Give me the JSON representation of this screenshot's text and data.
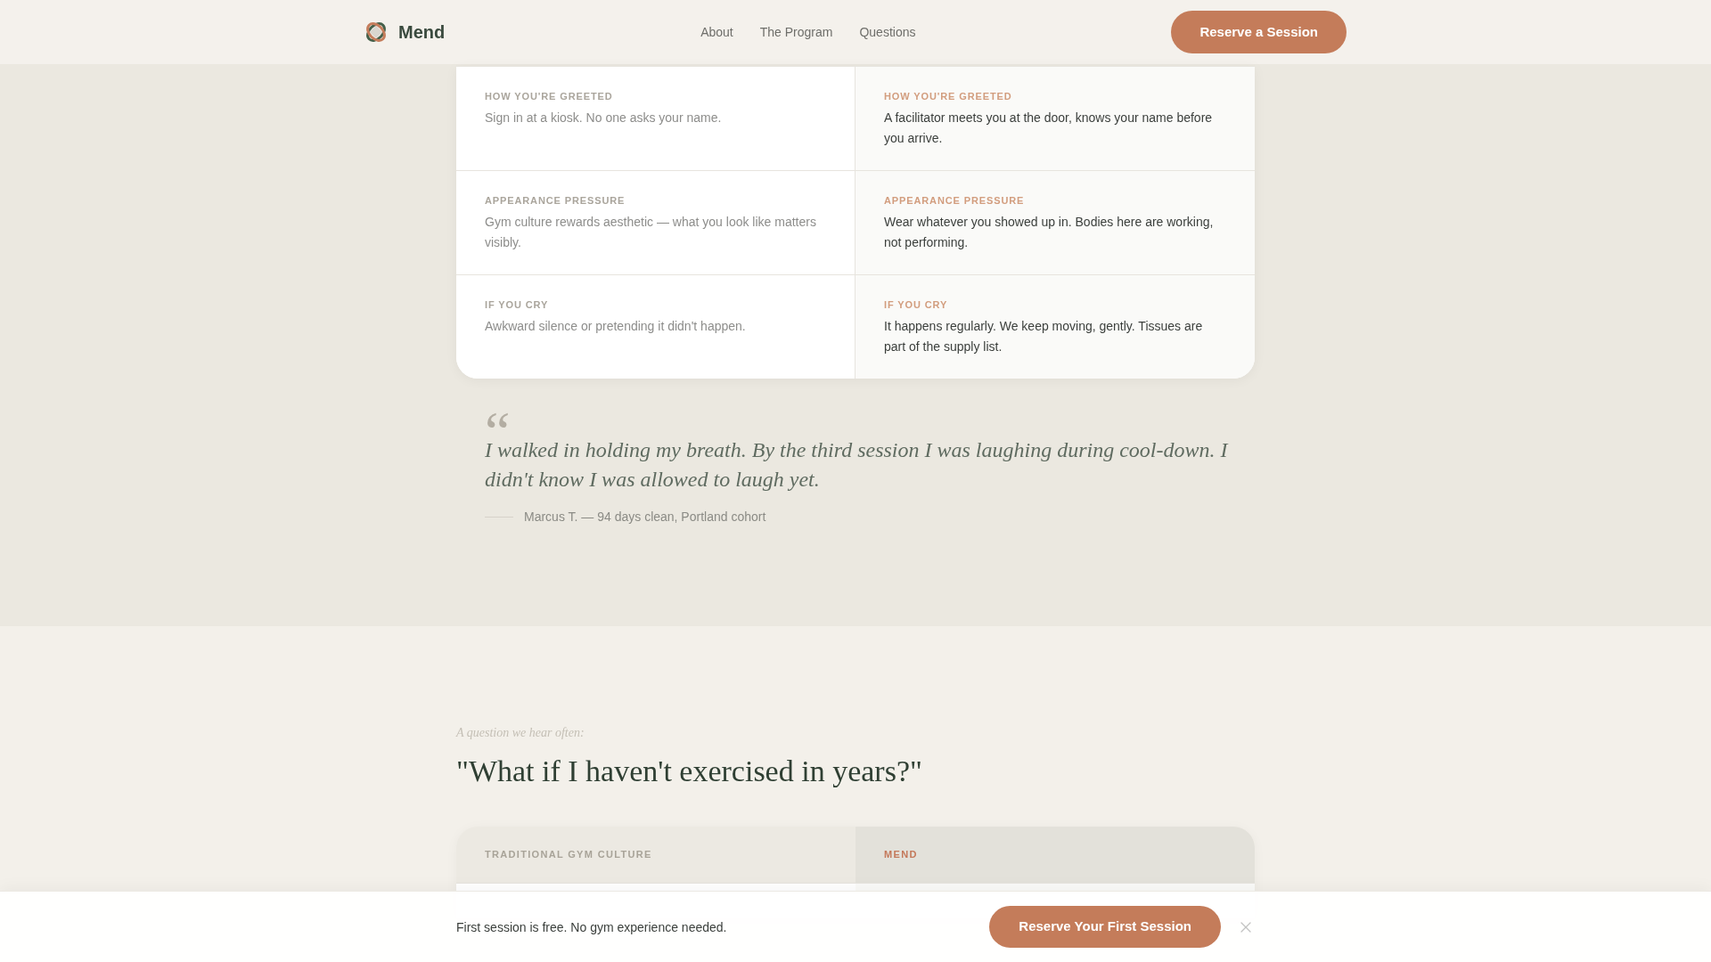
{
  "header": {
    "brand": "Mend",
    "nav": [
      {
        "label": "About"
      },
      {
        "label": "The Program"
      },
      {
        "label": "Questions"
      }
    ],
    "cta": "Reserve a Session"
  },
  "comparison": {
    "rows": [
      {
        "cells": [
          {
            "kind": "traditional",
            "label": "HOW YOU'RE GREETED",
            "text": "Sign in at a kiosk. No one asks your name."
          },
          {
            "kind": "mend",
            "label": "HOW YOU'RE GREETED",
            "text": "A facilitator meets you at the door, knows your name before you arrive."
          }
        ]
      },
      {
        "cells": [
          {
            "kind": "traditional",
            "label": "APPEARANCE PRESSURE",
            "text": "Gym culture rewards aesthetic — what you look like matters visibly."
          },
          {
            "kind": "mend",
            "label": "APPEARANCE PRESSURE",
            "text": "Wear whatever you showed up in. Bodies here are working, not performing."
          }
        ]
      },
      {
        "cells": [
          {
            "kind": "traditional",
            "label": "IF YOU CRY",
            "text": "Awkward silence or pretending it didn't happen."
          },
          {
            "kind": "mend",
            "label": "IF YOU CRY",
            "text": "It happens regularly. We keep moving, gently. Tissues are part of the supply list."
          }
        ]
      }
    ]
  },
  "testimonial": {
    "quote_mark": "“",
    "quote": "I walked in holding my breath. By the third session I was laughing during cool-down. I didn't know I was allowed to laugh yet.",
    "attribution": "Marcus T. — 94 days clean, Portland cohort"
  },
  "question_section": {
    "eyebrow": "A question we hear often:",
    "heading": "\"What if I haven't exercised in years?\"",
    "columns": [
      {
        "kind": "traditional",
        "label": "TRADITIONAL GYM CULTURE"
      },
      {
        "kind": "mend",
        "label": "MEND"
      }
    ]
  },
  "sticky_bar": {
    "text": "First session is free. No gym experience needed.",
    "cta": "Reserve Your First Session"
  }
}
